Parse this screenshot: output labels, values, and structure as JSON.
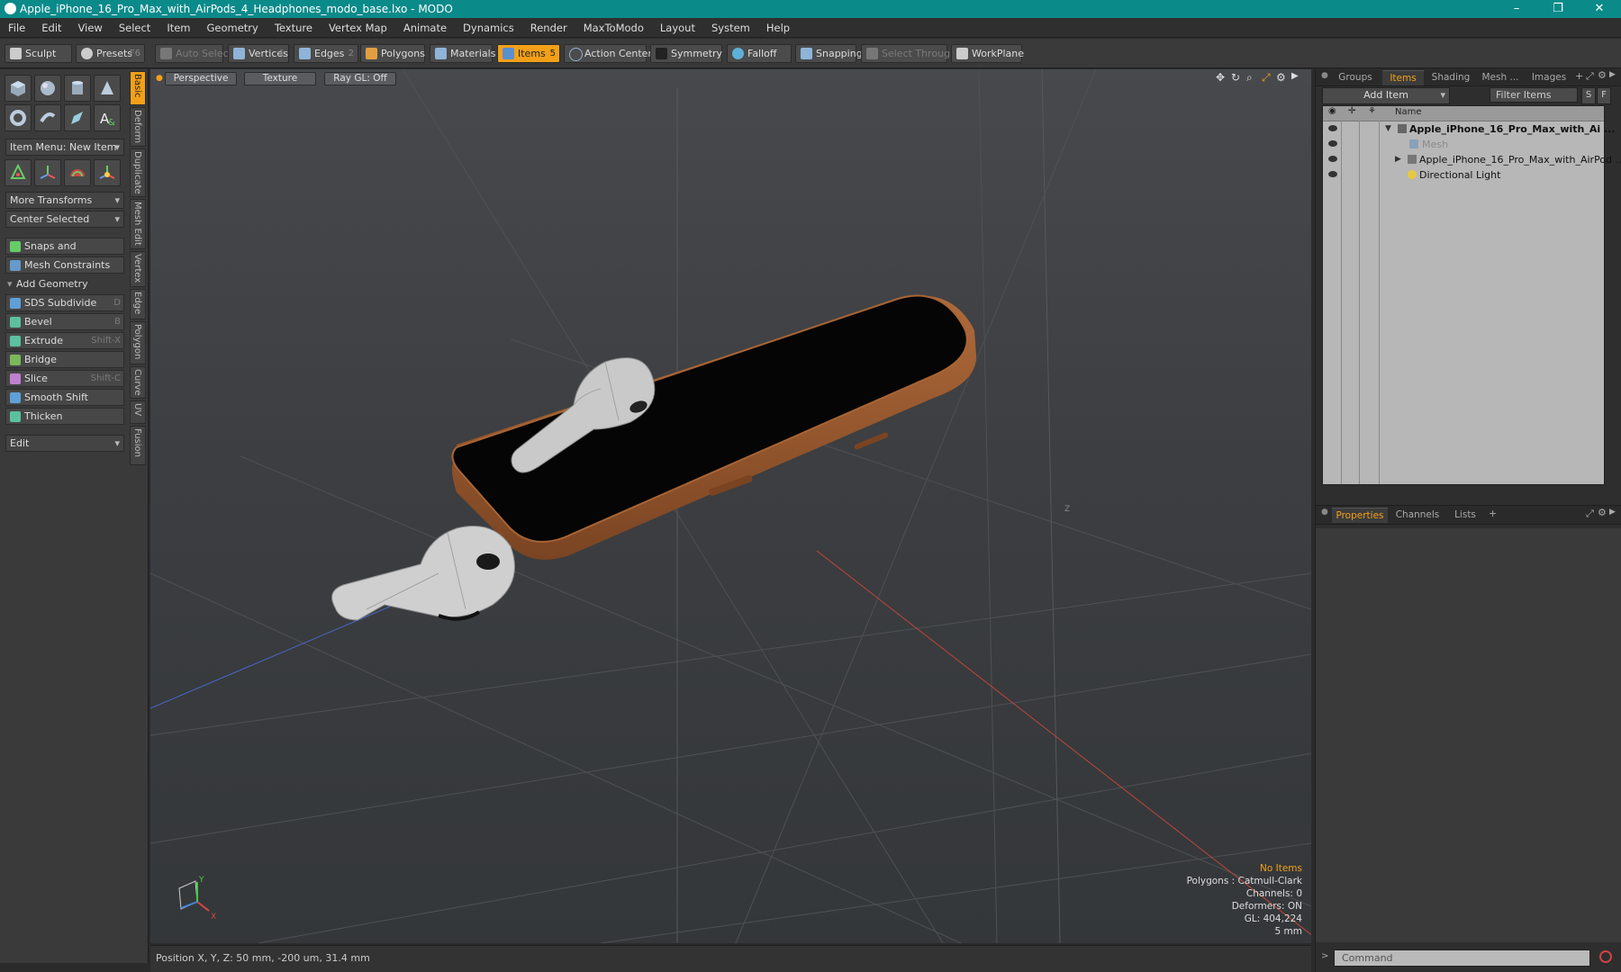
{
  "window": {
    "title": "Apple_iPhone_16_Pro_Max_with_AirPods_4_Headphones_modo_base.lxo - MODO",
    "min": "–",
    "max": "❐",
    "close": "✕"
  },
  "menu": [
    "File",
    "Edit",
    "View",
    "Select",
    "Item",
    "Geometry",
    "Texture",
    "Vertex Map",
    "Animate",
    "Dynamics",
    "Render",
    "MaxToModo",
    "Layout",
    "System",
    "Help"
  ],
  "toolbar": {
    "sculpt": "Sculpt",
    "presets": "Presets",
    "presets_key": "F6",
    "auto_select": "Auto Select",
    "vertices": "Vertices",
    "vertices_key": "1",
    "edges": "Edges",
    "edges_key": "2",
    "polygons": "Polygons",
    "materials": "Materials",
    "items": "Items",
    "items_key": "5",
    "action_center": "Action Center",
    "symmetry": "Symmetry",
    "falloff": "Falloff",
    "snapping": "Snapping",
    "select_through": "Select Through",
    "workplane": "WorkPlane"
  },
  "left": {
    "item_menu": "Item Menu: New Item",
    "more_transforms": "More Transforms",
    "center_selected": "Center Selected",
    "snaps": "Snaps and Precision",
    "mesh_constraints": "Mesh Constraints",
    "add_geometry": "Add Geometry",
    "tools": [
      {
        "label": "SDS Subdivide",
        "key": "D",
        "color": "#5fa0d8"
      },
      {
        "label": "Bevel",
        "key": "B",
        "color": "#5cc0a0"
      },
      {
        "label": "Extrude",
        "key": "Shift-X",
        "color": "#5cc0a0"
      },
      {
        "label": "Bridge",
        "key": "",
        "color": "#7ab85a"
      },
      {
        "label": "Slice",
        "key": "Shift-C",
        "color": "#c080d0"
      },
      {
        "label": "Smooth Shift",
        "key": "",
        "color": "#5fa0d8"
      },
      {
        "label": "Thicken",
        "key": "",
        "color": "#5cc0a0"
      }
    ],
    "edit": "Edit",
    "vtabs": [
      "Basic",
      "Deform",
      "Duplicate",
      "Mesh Edit",
      "Vertex",
      "Edge",
      "Polygon",
      "Curve",
      "UV",
      "Fusion"
    ]
  },
  "viewport": {
    "perspective": "Perspective",
    "texture": "Texture",
    "raygl": "Ray GL: Off",
    "info": {
      "no_items": "No Items",
      "polygons": "Polygons : Catmull-Clark",
      "channels": "Channels: 0",
      "deformers": "Deformers: ON",
      "gl": "GL: 404,224",
      "scale": "5 mm"
    },
    "axis_x": "X",
    "axis_y": "Y",
    "axis_z": "Z"
  },
  "status": {
    "position": "Position X, Y, Z:  50 mm, -200 um, 31.4 mm"
  },
  "right": {
    "tabs": [
      "Groups",
      "Items",
      "Shading",
      "Mesh ...",
      "Images"
    ],
    "add_item": "Add Item",
    "filter_items": "Filter Items",
    "s": "S",
    "f": "F",
    "name_col": "Name",
    "rows": [
      {
        "label": "Apple_iPhone_16_Pro_Max_with_Ai ..."
      },
      {
        "label": "Mesh"
      },
      {
        "label": "Apple_iPhone_16_Pro_Max_with_AirPod ..."
      },
      {
        "label": "Directional Light"
      }
    ],
    "bottom_tabs": [
      "Properties",
      "Channels",
      "Lists"
    ],
    "plus": "+",
    "command_placeholder": "Command"
  }
}
